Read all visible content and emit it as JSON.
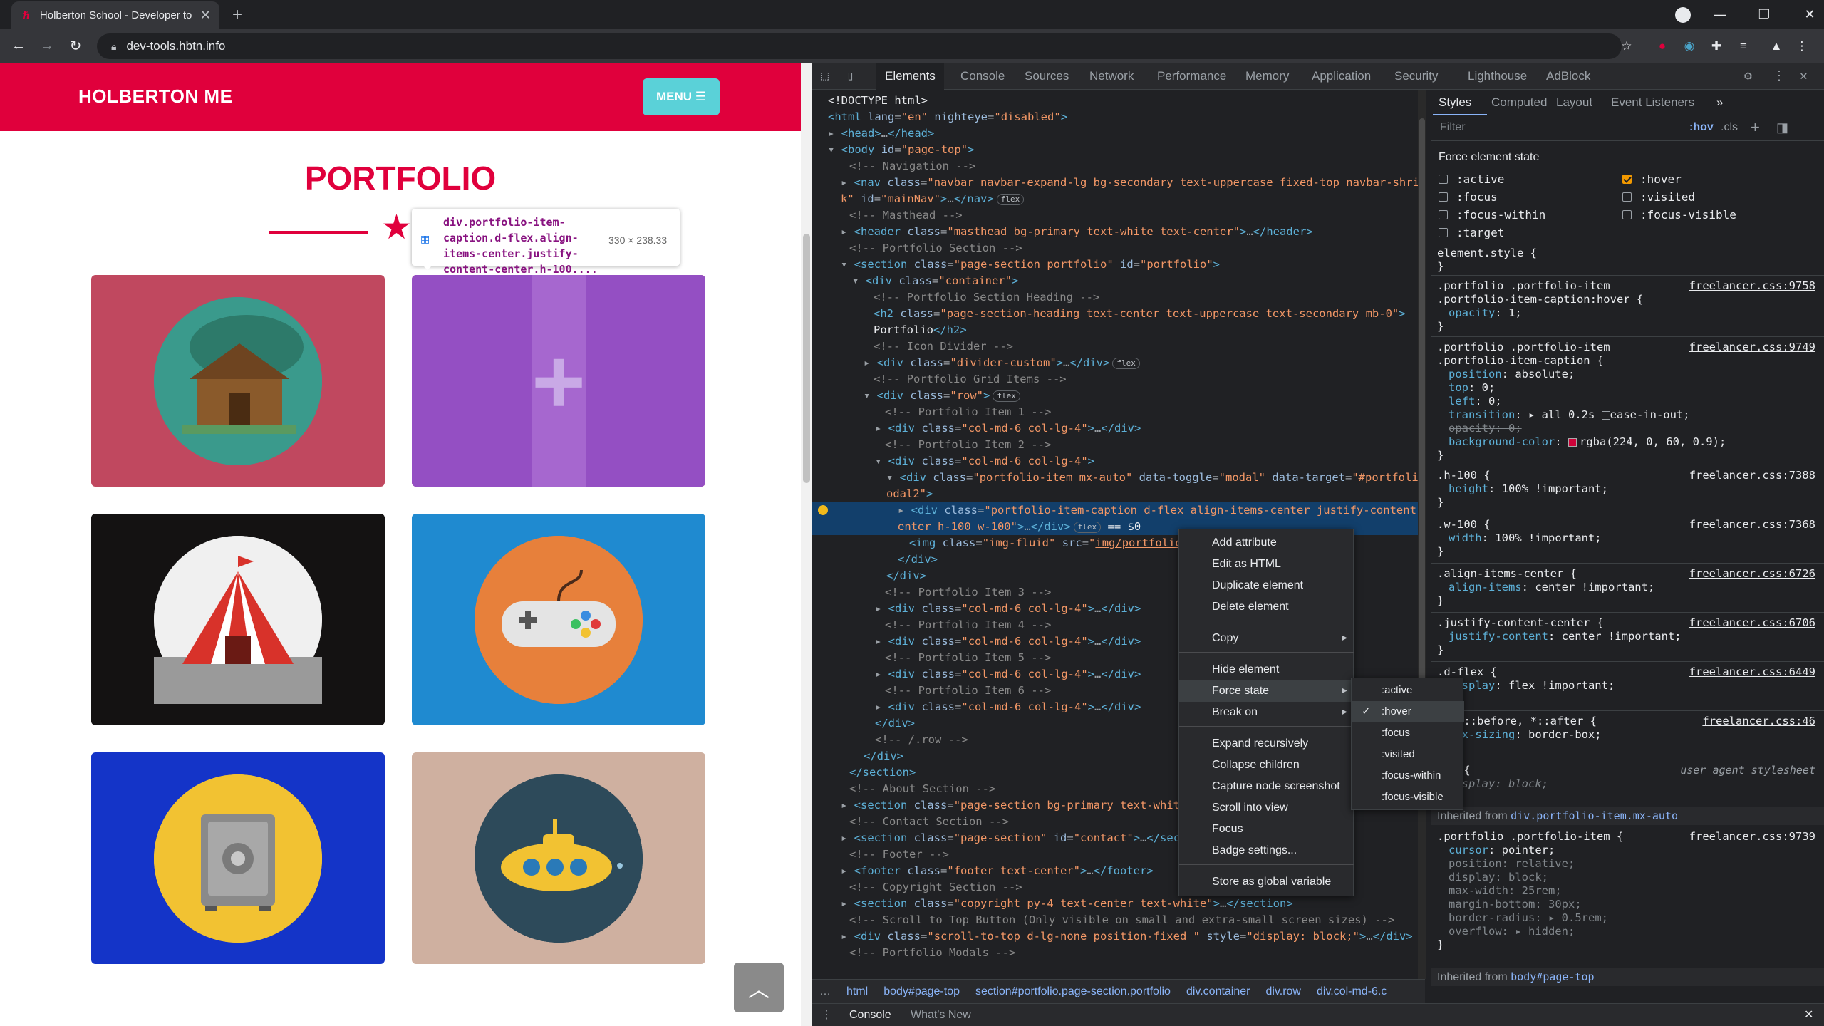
{
  "browser": {
    "tab_title": "Holberton School - Developer to",
    "url": "dev-tools.hbtn.info"
  },
  "page": {
    "brand": "HOLBERTON ME",
    "menu_label": "MENU ☰",
    "section_title": "PORTFOLIO",
    "tooltip_selector": "div.portfolio-item-caption.d-flex.align-items-center.justify-content-center.h-100....",
    "tooltip_size": "330 × 238.33",
    "cards": [
      {
        "bg": "#c0485f",
        "circle": "#3a9a8c",
        "icon": "cabin-icon"
      },
      {
        "bg": "#9150c8",
        "circle": "",
        "icon": "plus-icon"
      },
      {
        "bg": "#141212",
        "circle": "#f0f0f0",
        "icon": "circus-tent-icon"
      },
      {
        "bg": "#1f8ad0",
        "circle": "#e7803b",
        "icon": "game-controller-icon"
      },
      {
        "bg": "#1434c8",
        "circle": "#f2c232",
        "icon": "safe-icon"
      },
      {
        "bg": "#cfb0a0",
        "circle": "#2d4a5a",
        "icon": "submarine-icon"
      }
    ]
  },
  "devtools": {
    "tabs": [
      "Elements",
      "Console",
      "Sources",
      "Network",
      "Performance",
      "Memory",
      "Application",
      "Security",
      "Lighthouse",
      "AdBlock"
    ],
    "active_tab": "Elements",
    "breadcrumbs": [
      "html",
      "body#page-top",
      "section#portfolio.page-section.portfolio",
      "div.container",
      "div.row",
      "div.col-md-6.c"
    ],
    "drawer_tabs": [
      "Console",
      "What's New"
    ],
    "styles_tabs": [
      "Styles",
      "Computed",
      "Layout",
      "Event Listeners"
    ],
    "filter_placeholder": "Filter",
    "hov": ":hov",
    "cls": ".cls",
    "force_state_title": "Force element state",
    "force_states": [
      {
        "label": ":active",
        "checked": false
      },
      {
        "label": ":hover",
        "checked": true
      },
      {
        "label": ":focus",
        "checked": false
      },
      {
        "label": ":visited",
        "checked": false
      },
      {
        "label": ":focus-within",
        "checked": false
      },
      {
        "label": ":focus-visible",
        "checked": false
      },
      {
        "label": ":target",
        "checked": false
      }
    ],
    "inherited_1": "Inherited from",
    "inherited_1_sel": "div.portfolio-item.mx-auto",
    "inherited_2": "Inherited from",
    "inherited_2_sel": "body#page-top",
    "user_agent": "user agent stylesheet"
  },
  "context_menu": {
    "items": [
      "Add attribute",
      "Edit as HTML",
      "Duplicate element",
      "Delete element",
      "Copy",
      "Hide element",
      "Force state",
      "Break on",
      "Expand recursively",
      "Collapse children",
      "Capture node screenshot",
      "Scroll into view",
      "Focus",
      "Badge settings...",
      "Store as global variable"
    ],
    "submenu": [
      ":active",
      ":hover",
      ":focus",
      ":visited",
      ":focus-within",
      ":focus-visible"
    ]
  }
}
